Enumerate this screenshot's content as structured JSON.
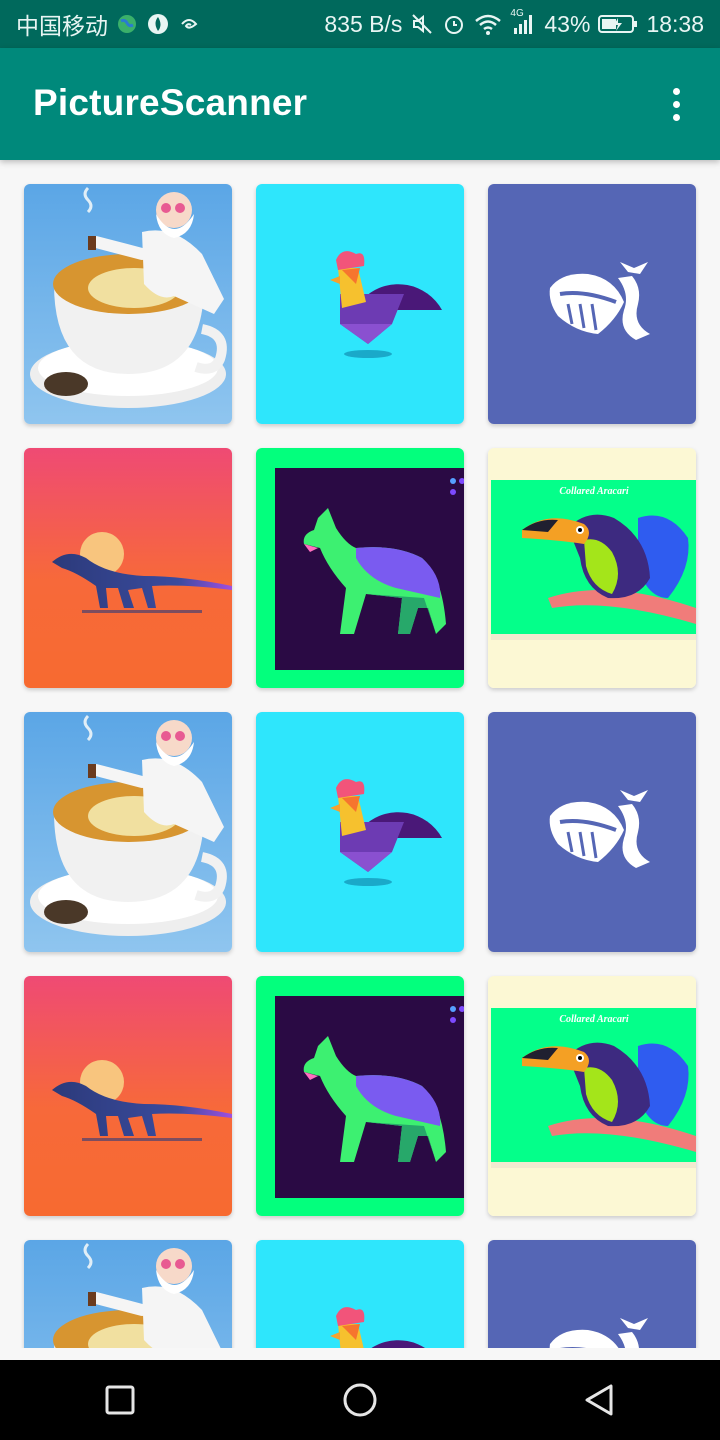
{
  "status_bar": {
    "carrier": "中国移动",
    "net_speed": "835 B/s",
    "network_type": "4G",
    "battery": "43%",
    "time": "18:38",
    "icons": [
      "earth-icon",
      "app-notification-icon",
      "swirl-icon",
      "mute-icon",
      "alarm-icon",
      "wifi-icon",
      "signal-icon",
      "battery-charging-icon"
    ]
  },
  "app_bar": {
    "title": "PictureScanner",
    "menu_icon": "more-vert-icon",
    "color": "#00897b"
  },
  "grid": {
    "columns": 3,
    "items": [
      {
        "image": "old-man-teacup"
      },
      {
        "image": "rooster"
      },
      {
        "image": "whale"
      },
      {
        "image": "dinosaur-sunset"
      },
      {
        "image": "dog-neon"
      },
      {
        "image": "toucan",
        "caption": "Collared Aracari"
      },
      {
        "image": "old-man-teacup"
      },
      {
        "image": "rooster"
      },
      {
        "image": "whale"
      },
      {
        "image": "dinosaur-sunset"
      },
      {
        "image": "dog-neon"
      },
      {
        "image": "toucan",
        "caption": "Collared Aracari"
      },
      {
        "image": "old-man-teacup"
      },
      {
        "image": "rooster"
      },
      {
        "image": "whale"
      }
    ]
  },
  "nav_bar": {
    "buttons": [
      "recents-square-icon",
      "home-circle-icon",
      "back-triangle-icon"
    ]
  }
}
